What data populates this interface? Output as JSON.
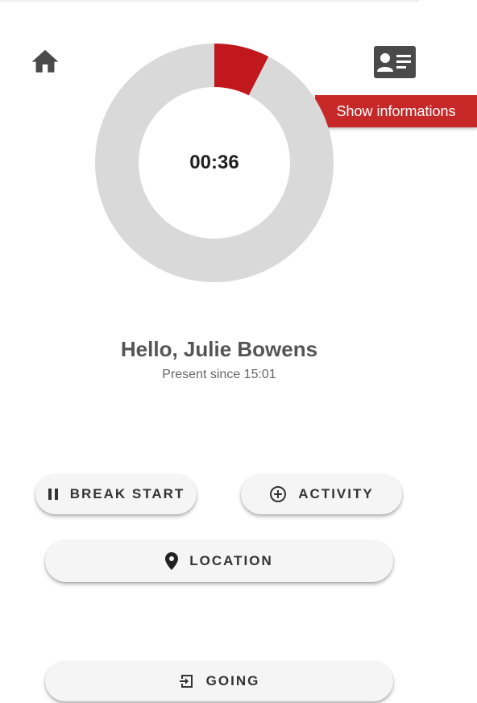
{
  "header": {
    "home_icon": "home-icon",
    "info_icon": "contact-card-icon",
    "tooltip": "Show informations"
  },
  "timer": {
    "display": "00:36",
    "progress_fraction": 0.075,
    "progress_color": "#c0181d",
    "track_color": "#d9d9d9"
  },
  "user": {
    "greeting": "Hello, Julie Bowens",
    "status": "Present since 15:01"
  },
  "actions": {
    "break_start": {
      "label": "BREAK START",
      "icon": "pause-icon"
    },
    "activity": {
      "label": "ACTIVITY",
      "icon": "add-circle-icon"
    },
    "location": {
      "label": "LOCATION",
      "icon": "location-pin-icon"
    },
    "going": {
      "label": "GOING",
      "icon": "exit-icon"
    }
  }
}
